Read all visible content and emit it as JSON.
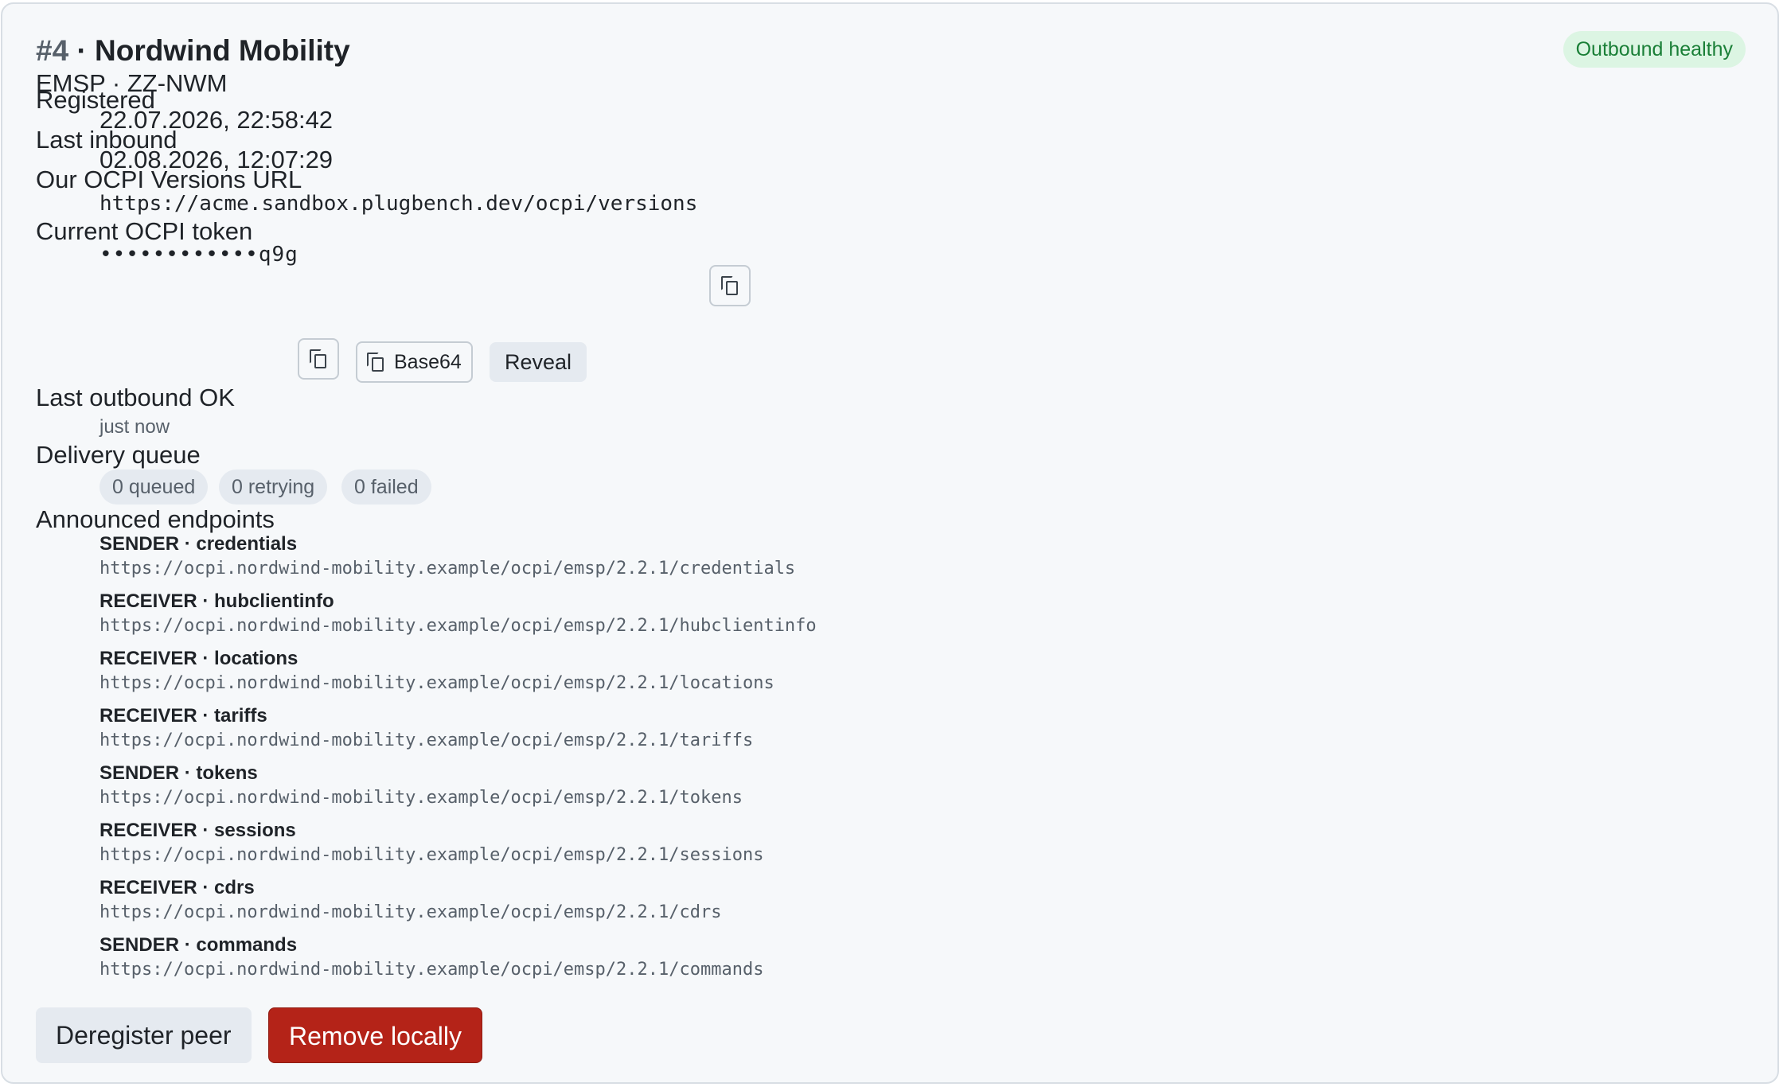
{
  "peer": {
    "number": "#4",
    "separator": "·",
    "name": "Nordwind Mobility",
    "subtitle": "EMSP · ZZ-NWM",
    "status_badge": "Outbound healthy",
    "status_color": "#1a7f37"
  },
  "fields": {
    "registered_label": "Registered",
    "registered_value": "22.07.2026, 22:58:42",
    "last_inbound_label": "Last inbound",
    "last_inbound_value": "02.08.2026, 12:07:29",
    "versions_url_label": "Our OCPI Versions URL",
    "versions_url_value": "https://acme.sandbox.plugbench.dev/ocpi/versions",
    "token_label": "Current OCPI token",
    "token_value": "••••••••••••q9g",
    "last_outbound_label": "Last outbound OK",
    "last_outbound_value": "just now",
    "queue_label": "Delivery queue",
    "endpoints_label": "Announced endpoints"
  },
  "token_actions": {
    "copy_icon": "copy-icon",
    "base64_label": "Base64",
    "reveal_label": "Reveal"
  },
  "queue": {
    "queued": "0 queued",
    "retrying": "0 retrying",
    "failed": "0 failed"
  },
  "endpoints": [
    {
      "heading": "SENDER · credentials",
      "url": "https://ocpi.nordwind-mobility.example/ocpi/emsp/2.2.1/credentials"
    },
    {
      "heading": "RECEIVER · hubclientinfo",
      "url": "https://ocpi.nordwind-mobility.example/ocpi/emsp/2.2.1/hubclientinfo"
    },
    {
      "heading": "RECEIVER · locations",
      "url": "https://ocpi.nordwind-mobility.example/ocpi/emsp/2.2.1/locations"
    },
    {
      "heading": "RECEIVER · tariffs",
      "url": "https://ocpi.nordwind-mobility.example/ocpi/emsp/2.2.1/tariffs"
    },
    {
      "heading": "SENDER · tokens",
      "url": "https://ocpi.nordwind-mobility.example/ocpi/emsp/2.2.1/tokens"
    },
    {
      "heading": "RECEIVER · sessions",
      "url": "https://ocpi.nordwind-mobility.example/ocpi/emsp/2.2.1/sessions"
    },
    {
      "heading": "RECEIVER · cdrs",
      "url": "https://ocpi.nordwind-mobility.example/ocpi/emsp/2.2.1/cdrs"
    },
    {
      "heading": "SENDER · commands",
      "url": "https://ocpi.nordwind-mobility.example/ocpi/emsp/2.2.1/commands"
    }
  ],
  "actions": {
    "deregister_label": "Deregister peer",
    "remove_label": "Remove locally",
    "danger_color": "#b42318"
  }
}
